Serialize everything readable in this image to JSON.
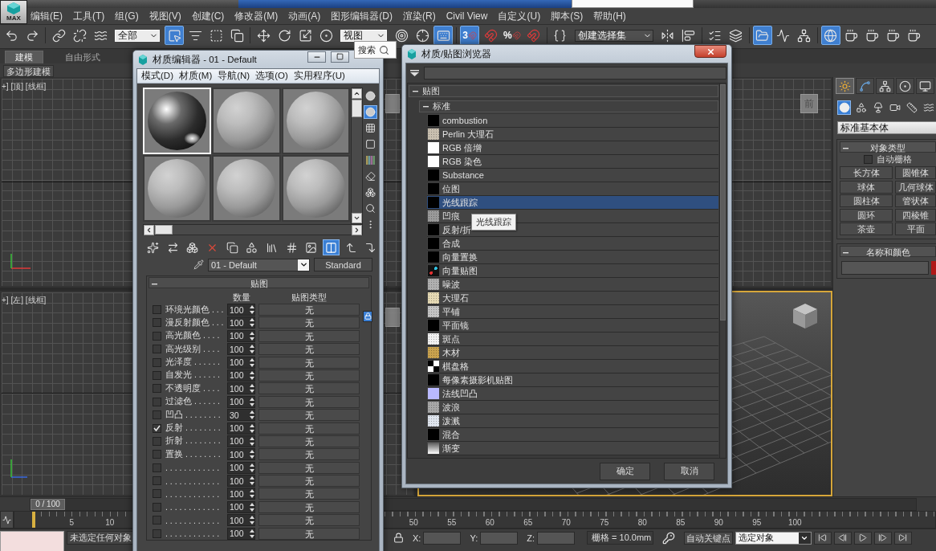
{
  "app_button": {
    "label": "MAX"
  },
  "menu_bar": [
    "编辑(E)",
    "工具(T)",
    "组(G)",
    "视图(V)",
    "创建(C)",
    "修改器(M)",
    "动画(A)",
    "图形编辑器(D)",
    "渲染(R)",
    "Civil View",
    "自定义(U)",
    "脚本(S)",
    "帮助(H)"
  ],
  "main_toolbar": {
    "buttons": [
      {
        "on": false
      },
      {
        "on": false
      },
      {
        "on": false
      },
      {
        "on": false
      },
      {
        "on": false
      },
      {
        "on": true
      },
      {
        "on": false
      },
      {
        "on": false
      },
      {
        "on": false
      },
      {
        "on": false
      },
      {
        "on": false
      },
      {
        "on": false
      },
      {
        "on": false
      },
      {
        "on": false
      },
      {
        "on": false
      },
      {
        "on": true
      },
      {
        "on": true,
        "label": "3"
      },
      {
        "on": false
      },
      {
        "on": false,
        "label": "%"
      },
      {
        "on": false
      },
      {
        "on": false
      },
      {
        "on": false
      },
      {
        "on": false
      },
      {
        "on": false
      },
      {
        "on": false
      },
      {
        "on": true
      },
      {
        "on": false
      },
      {
        "on": false
      },
      {
        "on": true
      },
      {
        "on": false
      },
      {
        "on": false
      },
      {
        "on": false
      },
      {
        "on": false
      }
    ],
    "selection_filter": "全部",
    "reference_coordinate_system": "视图",
    "named_selection_set": "创建选择集"
  },
  "ribbon": {
    "tabs": [
      {
        "label": "建模",
        "selected": true
      },
      {
        "label": "自由形式",
        "selected": false
      }
    ],
    "panel_button": "多边形建模"
  },
  "viewports": [
    {
      "kind": "top",
      "label": "+] [顶] [线框]",
      "active": false
    },
    {
      "kind": "front",
      "view_cube": "前",
      "active": false
    },
    {
      "kind": "left",
      "label": "+] [左] [线框]",
      "active": false
    },
    {
      "kind": "perspective",
      "active": true
    }
  ],
  "command_panel": {
    "tabs": [
      {
        "selected": true
      },
      {
        "selected": false
      },
      {
        "selected": false
      },
      {
        "selected": false
      },
      {
        "selected": false
      }
    ],
    "categories": [
      {
        "selected": true
      },
      {
        "selected": false
      },
      {
        "selected": false
      },
      {
        "selected": false
      },
      {
        "selected": false
      },
      {
        "selected": false
      }
    ],
    "category_dropdown": "标准基本体",
    "rollouts": [
      {
        "kind": "object_type",
        "title": "对象类型",
        "expanded": true,
        "autogrid": {
          "label": "自动栅格",
          "checked": false
        },
        "buttons": [
          "长方体",
          "圆锥体",
          "球体",
          "几何球体",
          "圆柱体",
          "管状体",
          "圆环",
          "四棱锥",
          "茶壶",
          "平面"
        ]
      },
      {
        "kind": "name_color",
        "title": "名称和颜色",
        "expanded": true
      }
    ]
  },
  "time_slider": {
    "position": "0 / 100",
    "level": 0
  },
  "track_bar": {
    "start_labels": [
      "5",
      "10"
    ],
    "end_labels": [
      "50",
      "55",
      "60",
      "65",
      "70",
      "75",
      "80",
      "85",
      "90",
      "95",
      "100"
    ]
  },
  "status_bar": {
    "selection_message": "未选定任何对象",
    "coordinate_labels": [
      "X:",
      "Y:",
      "Z:"
    ],
    "grid_spacing": "栅格 = 10.0mm",
    "auto_key_button": "自动关键点",
    "key_filter": "选定对象"
  },
  "search_tooltip": "搜索",
  "material_editor": {
    "title": "材质编辑器 - 01 - Default",
    "menu": [
      "模式(D)",
      "材质(M)",
      "导航(N)",
      "选项(O)",
      "实用程序(U)"
    ],
    "sample_slots": [
      {
        "selected": true,
        "kind": "glossy"
      },
      {
        "selected": false,
        "kind": "matte"
      },
      {
        "selected": false,
        "kind": "matte"
      },
      {
        "selected": false,
        "kind": "matte"
      },
      {
        "selected": false,
        "kind": "matte"
      },
      {
        "selected": false,
        "kind": "matte"
      }
    ],
    "side_tools": [
      {
        "on": false
      },
      {
        "on": true
      },
      {
        "on": false
      },
      {
        "on": false
      },
      {
        "on": false
      },
      {
        "on": false
      },
      {
        "on": false
      },
      {
        "on": false
      },
      {
        "on": false
      }
    ],
    "tools": [
      {
        "on": false
      },
      {
        "on": false
      },
      {
        "on": false
      },
      {
        "on": false
      },
      {
        "on": false
      },
      {
        "on": false
      },
      {
        "on": false
      },
      {
        "on": false
      },
      {
        "on": false
      },
      {
        "on": true
      },
      {
        "on": false
      },
      {
        "on": false
      }
    ],
    "material_name": "01 - Default",
    "material_type": "Standard",
    "maps": {
      "title": "贴图",
      "expanded": true,
      "columns": [
        "数量",
        "贴图类型"
      ],
      "lock_on": true,
      "rows": [
        {
          "label": "环境光颜色 . . .",
          "checked": false,
          "amount": "100",
          "map": "无"
        },
        {
          "label": "漫反射颜色 . . .",
          "checked": false,
          "amount": "100",
          "map": "无"
        },
        {
          "label": "高光颜色 . . . .",
          "checked": false,
          "amount": "100",
          "map": "无"
        },
        {
          "label": "高光级别 . . . .",
          "checked": false,
          "amount": "100",
          "map": "无"
        },
        {
          "label": "光泽度 . . . . . .",
          "checked": false,
          "amount": "100",
          "map": "无"
        },
        {
          "label": "自发光 . . . . . .",
          "checked": false,
          "amount": "100",
          "map": "无"
        },
        {
          "label": "不透明度 . . . .",
          "checked": false,
          "amount": "100",
          "map": "无"
        },
        {
          "label": "过滤色 . . . . . .",
          "checked": false,
          "amount": "100",
          "map": "无"
        },
        {
          "label": "凹凸 . . . . . . . .",
          "checked": false,
          "amount": "30",
          "map": "无"
        },
        {
          "label": "反射 . . . . . . . .",
          "checked": true,
          "amount": "100",
          "map": "无"
        },
        {
          "label": "折射 . . . . . . . .",
          "checked": false,
          "amount": "100",
          "map": "无"
        },
        {
          "label": "置换 . . . . . . . .",
          "checked": false,
          "amount": "100",
          "map": "无"
        },
        {
          "label": ". . . . . . . . . . . .",
          "checked": false,
          "amount": "100",
          "map": "无"
        },
        {
          "label": ". . . . . . . . . . . .",
          "checked": false,
          "amount": "100",
          "map": "无"
        },
        {
          "label": ". . . . . . . . . . . .",
          "checked": false,
          "amount": "100",
          "map": "无"
        },
        {
          "label": ". . . . . . . . . . . .",
          "checked": false,
          "amount": "100",
          "map": "无"
        },
        {
          "label": ". . . . . . . . . . . .",
          "checked": false,
          "amount": "100",
          "map": "无"
        },
        {
          "label": ". . . . . . . . . . . .",
          "checked": false,
          "amount": "100",
          "map": "无"
        }
      ]
    }
  },
  "material_browser": {
    "title": "材质/贴图浏览器",
    "groups": [
      {
        "label": "贴图",
        "expanded": true,
        "children": [
          {
            "label": "标准",
            "expanded": true,
            "items": [
              {
                "label": "combustion",
                "kind": "solid",
                "color": "#000000",
                "selected": false
              },
              {
                "label": "Perlin 大理石",
                "kind": "texture",
                "color": "#c9c0b0",
                "selected": false
              },
              {
                "label": "RGB 倍增",
                "kind": "solid",
                "color": "#ffffff",
                "selected": false
              },
              {
                "label": "RGB 染色",
                "kind": "solid",
                "color": "#ffffff",
                "selected": false
              },
              {
                "label": "Substance",
                "kind": "solid",
                "color": "#000000",
                "selected": false
              },
              {
                "label": "位图",
                "kind": "solid",
                "color": "#000000",
                "selected": false
              },
              {
                "label": "光线跟踪",
                "kind": "solid",
                "color": "#000000",
                "selected": true
              },
              {
                "label": "凹痕",
                "kind": "texture",
                "color": "#9a9a9a",
                "selected": false
              },
              {
                "label": "反射/折",
                "kind": "solid",
                "color": "#000000",
                "selected": false
              },
              {
                "label": "合成",
                "kind": "solid",
                "color": "#000000",
                "selected": false
              },
              {
                "label": "向量置换",
                "kind": "solid",
                "color": "#000000",
                "selected": false
              },
              {
                "label": "向量贴图",
                "kind": "vector",
                "color": "#111111",
                "selected": false
              },
              {
                "label": "噪波",
                "kind": "texture",
                "color": "#b0b0b0",
                "selected": false
              },
              {
                "label": "大理石",
                "kind": "texture",
                "color": "#e6dab4",
                "selected": false
              },
              {
                "label": "平铺",
                "kind": "texture",
                "color": "#c4c4c4",
                "selected": false
              },
              {
                "label": "平面镜",
                "kind": "solid",
                "color": "#000000",
                "selected": false
              },
              {
                "label": "斑点",
                "kind": "texture",
                "color": "#f2f2f2",
                "selected": false
              },
              {
                "label": "木材",
                "kind": "texture",
                "color": "#c9a24e",
                "selected": false
              },
              {
                "label": "棋盘格",
                "kind": "checker",
                "color": "#000000",
                "selected": false
              },
              {
                "label": "每像素摄影机贴图",
                "kind": "solid",
                "color": "#000000",
                "selected": false
              },
              {
                "label": "法线凹凸",
                "kind": "solid",
                "color": "#b9b9ff",
                "selected": false
              },
              {
                "label": "波浪",
                "kind": "texture",
                "color": "#a8a8a8",
                "selected": false
              },
              {
                "label": "泼溅",
                "kind": "texture",
                "color": "#dfe5ee",
                "selected": false
              },
              {
                "label": "混合",
                "kind": "solid",
                "color": "#000000",
                "selected": false
              },
              {
                "label": "渐变",
                "kind": "gradient",
                "color": "#ffffff",
                "selected": false
              }
            ]
          }
        ]
      }
    ],
    "tooltip": "光线跟踪",
    "buttons": [
      "确定",
      "取消"
    ]
  }
}
